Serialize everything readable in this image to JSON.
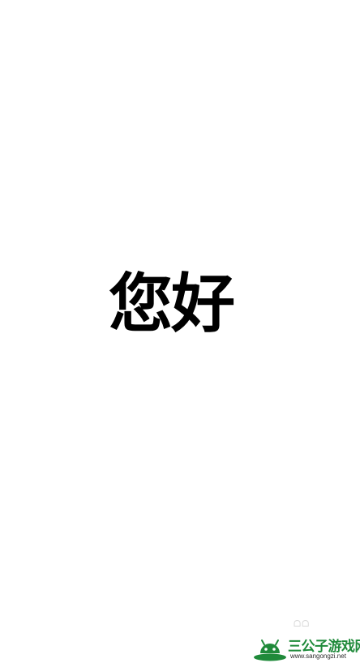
{
  "screen": {
    "greeting_text": "您好"
  },
  "watermark": {
    "faint_mark": "ᗝᗝ",
    "brand_name": "三公子游戏网",
    "brand_url": "www.sangongzi.net",
    "logo_icon": "android-robot-icon",
    "brand_color": "#1f8a3a"
  }
}
